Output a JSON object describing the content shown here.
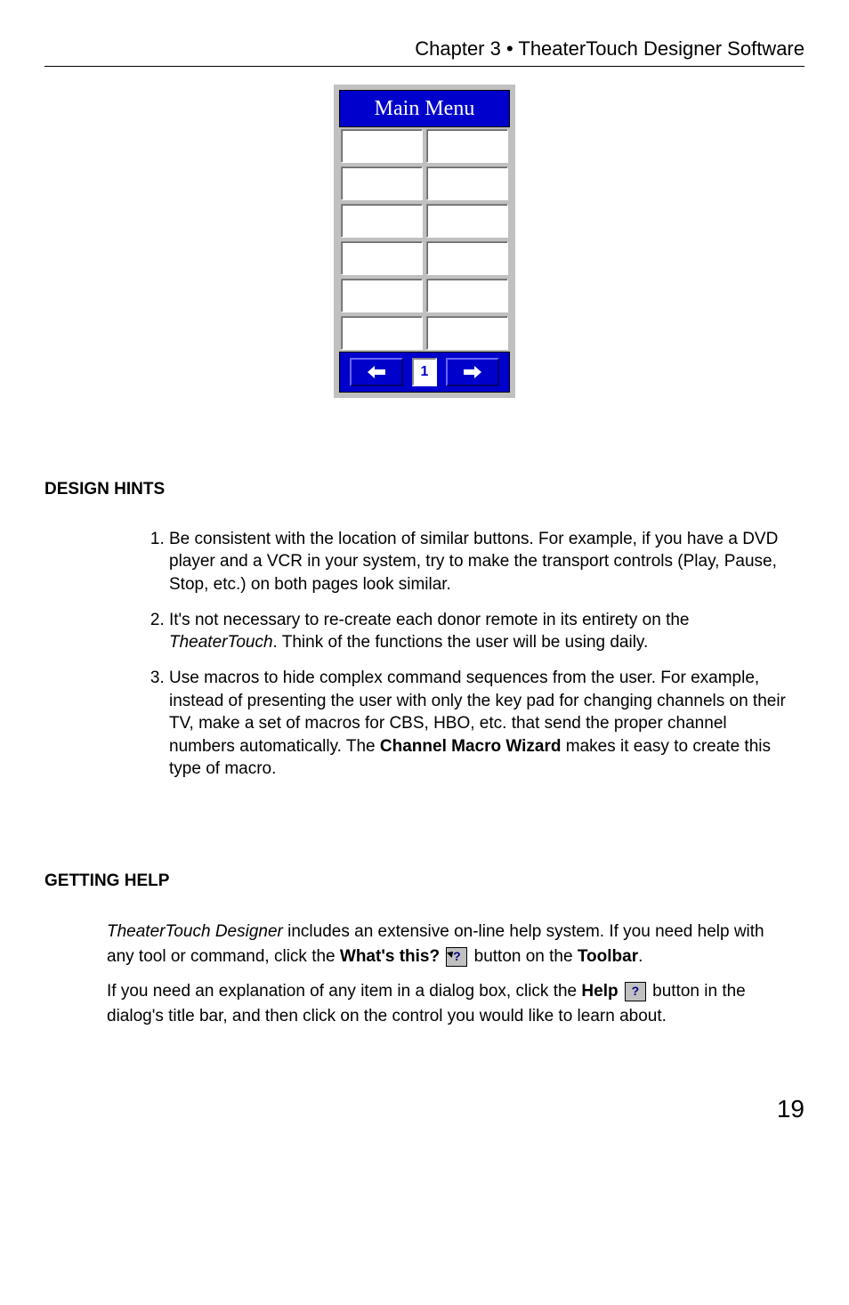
{
  "header": "Chapter 3 • TheaterTouch Designer Software",
  "device": {
    "title": "Main Menu",
    "page_number": "1"
  },
  "sections": {
    "design_hints": {
      "title": "DESIGN HINTS",
      "items": [
        {
          "num": "1.",
          "pre": "Be consistent with the location of similar buttons.  For example, if you have a DVD player and a VCR in your system, try to make the transport controls (Play, Pause, Stop, etc.) on both pages look similar."
        },
        {
          "num": "2.",
          "pre": "It's not necessary to re-create each donor remote in its entirety on the ",
          "italic": "TheaterTouch",
          "post": ".  Think of the functions the user will be using daily."
        },
        {
          "num": "3.",
          "pre": "Use macros to hide complex command sequences from the user.  For example, instead of presenting the user with only the key pad for changing channels on their TV, make a set of macros for CBS, HBO, etc. that send the proper channel numbers automatically.  The ",
          "bold": "Channel Macro Wizard",
          "post": " makes it easy to create this type of macro."
        }
      ]
    },
    "getting_help": {
      "title": "GETTING HELP",
      "p1_italic": "TheaterTouch Designer",
      "p1_a": " includes an extensive on-line help system. If you need help with any tool or command, click the ",
      "p1_bold1": "What's this?",
      "p1_b": " button on the ",
      "p1_bold2": "Toolbar",
      "p1_c": ".",
      "p2_a": "If you need an explanation of any item in a dialog box, click the ",
      "p2_bold": "Help",
      "p2_b": " button in the dialog's title bar, and then click on the control you would like to learn about."
    }
  },
  "page_number": "19"
}
